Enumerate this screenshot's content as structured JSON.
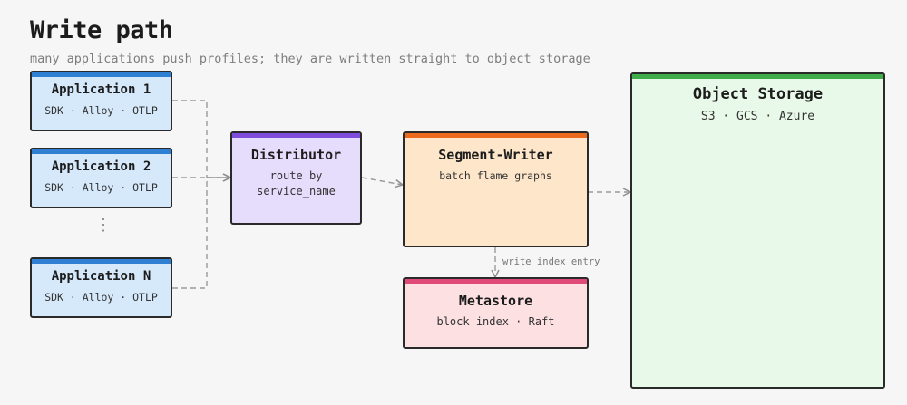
{
  "header": {
    "title": "Write path",
    "subtitle": "many applications push profiles; they are written straight to object storage"
  },
  "nodes": {
    "app1": {
      "name": "Application 1",
      "desc": "SDK · Alloy · OTLP"
    },
    "app2": {
      "name": "Application 2",
      "desc": "SDK · Alloy · OTLP"
    },
    "ellipsis": "⋮",
    "appN": {
      "name": "Application N",
      "desc": "SDK · Alloy · OTLP"
    },
    "distributor": {
      "name": "Distributor",
      "desc": "route by\nservice_name"
    },
    "segment_writer": {
      "name": "Segment-Writer",
      "desc": "batch flame graphs"
    },
    "metastore": {
      "name": "Metastore",
      "desc": "block index · Raft"
    },
    "object_storage": {
      "name": "Object Storage",
      "desc": "S3 · GCS · Azure"
    }
  },
  "edges": {
    "write_index_label": "write index entry"
  },
  "colors": {
    "application": "#2f7fd3",
    "distributor": "#7e4ddb",
    "segment_writer": "#ec6a1e",
    "metastore": "#e04a78",
    "object_storage": "#3fae4a",
    "arrow": "#9a9a9a"
  }
}
